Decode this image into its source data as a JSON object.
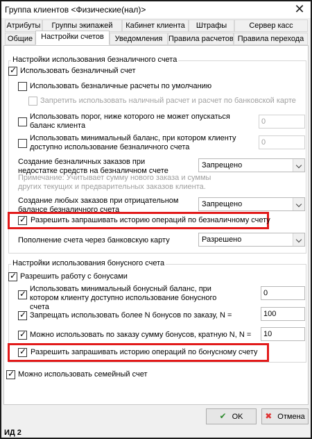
{
  "window": {
    "title": "Группа клиентов <Физические(нал)>",
    "close_glyph": "✕"
  },
  "tabs": {
    "row1": [
      "Атрибуты",
      "Группы экипажей",
      "Кабинет клиента",
      "Штрафы",
      "Сервер касс"
    ],
    "row2": [
      "Общие",
      "Настройки счетов",
      "Уведомления",
      "Правила расчетов",
      "Правила перехода"
    ]
  },
  "cashless": {
    "legend": "Настройки использования безналичного счета",
    "use_cashless": "Использовать безналичный счет",
    "use_cashless_default": "Использовать безналичные расчеты по умолчанию",
    "forbid_cash_card": "Запретить использовать наличный расчет и расчет по банковской карте",
    "threshold_label": "Использовать порог, ниже которого не может опускаться баланс клиента",
    "threshold_value": "0",
    "min_balance_label": "Использовать минимальный баланс, при котором клиенту доступно использование безналичного счета",
    "min_balance_value": "0",
    "create_insufficient_label": "Создание безналичных заказов при недостатке средств на безналичном счете",
    "create_insufficient_value": "Запрещено",
    "note": "Примечание: Учитывает сумму нового заказа и суммы других текущих и предварительных заказов клиента.",
    "create_negative_label": "Создание любых заказов при отрицательном балансе безналичного счета",
    "create_negative_value": "Запрещено",
    "allow_history": "Разрешить запрашивать историю операций по безналичному счету",
    "topup_label": "Пополнение счета через банковскую карту",
    "topup_value": "Разрешено"
  },
  "bonus": {
    "legend": "Настройки использования бонусного счета",
    "allow_bonus": "Разрешить работу с бонусами",
    "min_bonus_label": "Использовать минимальный бонусный баланс, при котором клиенту доступно использование бонусного счета",
    "min_bonus_value": "0",
    "forbid_more_n_label": "Запрещать использовать более N бонусов по заказу, N =",
    "forbid_more_n_value": "100",
    "multiple_n_label": "Можно использовать по заказу сумму бонусов, кратную N, N =",
    "multiple_n_value": "10",
    "allow_history": "Разрешить запрашивать историю операций по бонусному счету"
  },
  "family": {
    "label": "Можно использовать семейный счет"
  },
  "buttons": {
    "ok": "OK",
    "cancel": "Отмена",
    "ok_icon": "check-icon",
    "cancel_icon": "cross-icon"
  },
  "footer": {
    "id": "ИД 2"
  },
  "colors": {
    "highlight": "#e21a1a",
    "ok_icon": "#2e8b2e",
    "cancel_icon": "#e03232"
  }
}
